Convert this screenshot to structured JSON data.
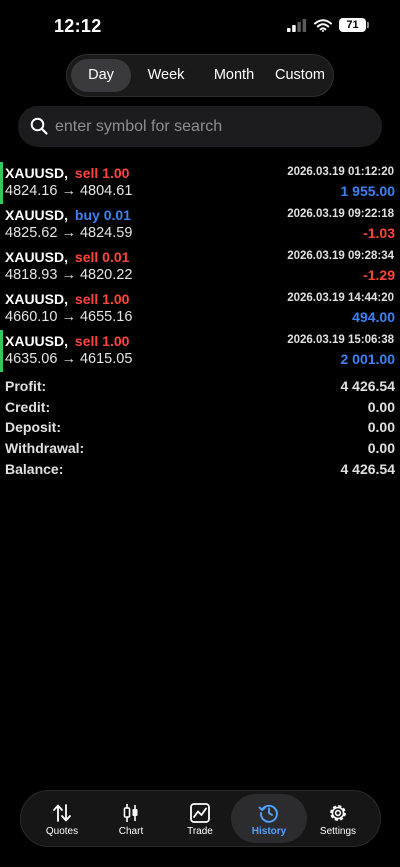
{
  "status": {
    "time": "12:12",
    "battery": "71"
  },
  "period_tabs": [
    {
      "label": "Day",
      "active": true
    },
    {
      "label": "Week",
      "active": false
    },
    {
      "label": "Month",
      "active": false
    },
    {
      "label": "Custom",
      "active": false
    }
  ],
  "search": {
    "placeholder": "enter symbol for search"
  },
  "trades": [
    {
      "symbol": "XAUUSD",
      "side": "sell",
      "volume": "1.00",
      "open": "4824.16",
      "close": "4804.61",
      "time": "2026.03.19 01:12:20",
      "pl": "1 955.00",
      "highlight": true
    },
    {
      "symbol": "XAUUSD",
      "side": "buy",
      "volume": "0.01",
      "open": "4825.62",
      "close": "4824.59",
      "time": "2026.03.19 09:22:18",
      "pl": "-1.03",
      "highlight": false
    },
    {
      "symbol": "XAUUSD",
      "side": "sell",
      "volume": "0.01",
      "open": "4818.93",
      "close": "4820.22",
      "time": "2026.03.19 09:28:34",
      "pl": "-1.29",
      "highlight": false
    },
    {
      "symbol": "XAUUSD",
      "side": "sell",
      "volume": "1.00",
      "open": "4660.10",
      "close": "4655.16",
      "time": "2026.03.19 14:44:20",
      "pl": "494.00",
      "highlight": false
    },
    {
      "symbol": "XAUUSD",
      "side": "sell",
      "volume": "1.00",
      "open": "4635.06",
      "close": "4615.05",
      "time": "2026.03.19 15:06:38",
      "pl": "2 001.00",
      "highlight": true
    }
  ],
  "summary": [
    {
      "label": "Profit:",
      "value": "4 426.54"
    },
    {
      "label": "Credit:",
      "value": "0.00"
    },
    {
      "label": "Deposit:",
      "value": "0.00"
    },
    {
      "label": "Withdrawal:",
      "value": "0.00"
    },
    {
      "label": "Balance:",
      "value": "4 426.54"
    }
  ],
  "tabbar": [
    {
      "label": "Quotes",
      "icon": "quotes-arrows-icon",
      "active": false
    },
    {
      "label": "Chart",
      "icon": "candlestick-chart-icon",
      "active": false
    },
    {
      "label": "Trade",
      "icon": "trade-chart-icon",
      "active": false
    },
    {
      "label": "History",
      "icon": "history-clock-icon",
      "active": true
    },
    {
      "label": "Settings",
      "icon": "gear-icon",
      "active": false
    }
  ],
  "colors": {
    "sell": "#ff453a",
    "buy": "#3b82f6",
    "profit": "#3b82f6",
    "loss": "#ff453a",
    "highlight_bar": "#35c759",
    "active_tab": "#4da3ff"
  }
}
